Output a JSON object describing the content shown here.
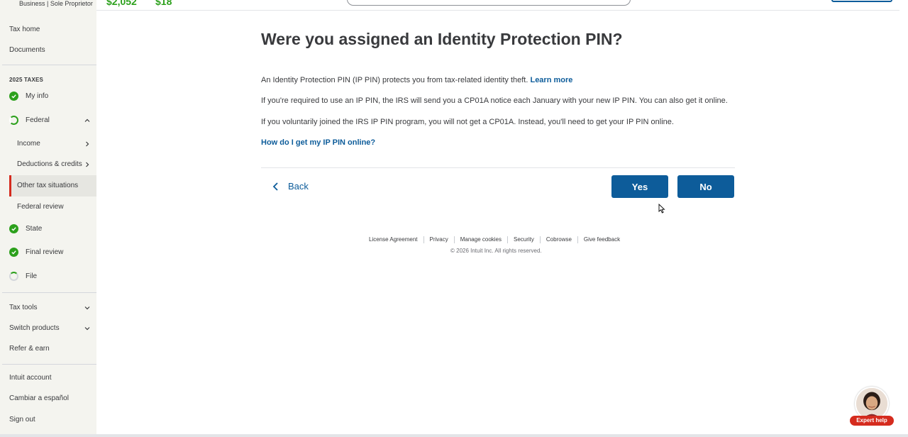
{
  "header": {
    "subtitle": "Business | Sole Proprietor",
    "federal_refund": "$2,052",
    "state_refund": "$18"
  },
  "sidebar": {
    "tax_home": "Tax home",
    "documents": "Documents",
    "section_title": "2025 TAXES",
    "my_info": "My info",
    "federal": "Federal",
    "income": "Income",
    "deductions_credits": "Deductions & credits",
    "other_tax_situations": "Other tax situations",
    "federal_review": "Federal review",
    "state": "State",
    "final_review": "Final review",
    "file": "File",
    "tax_tools": "Tax tools",
    "switch_products": "Switch products",
    "refer_earn": "Refer & earn",
    "intuit_account": "Intuit account",
    "cambiar_espanol": "Cambiar a español",
    "sign_out": "Sign out"
  },
  "main": {
    "title": "Were you assigned an Identity Protection PIN?",
    "para1": "An Identity Protection PIN (IP PIN) protects you from tax-related identity theft.",
    "learn_more": "Learn more",
    "para2": "If you're required to use an IP PIN, the IRS will send you a CP01A notice each January with your new IP PIN. You can also get it online.",
    "para3": "If you voluntarily joined the IRS IP PIN program, you will not get a CP01A. Instead, you'll need to get your IP PIN online.",
    "help_link": "How do I get my IP PIN online?",
    "back": "Back",
    "yes": "Yes",
    "no": "No"
  },
  "footer": {
    "license": "License Agreement",
    "privacy": "Privacy",
    "cookies": "Manage cookies",
    "security": "Security",
    "cobrowse": "Cobrowse",
    "feedback": "Give feedback",
    "copyright": "© 2026 Intuit Inc. All rights reserved."
  },
  "expert_help": {
    "label": "Expert help"
  },
  "colors": {
    "accent_blue": "#0d5c9a",
    "success_green": "#2ca01c",
    "active_red": "#d52b1e",
    "sidebar_bg": "#f4f4ef"
  }
}
